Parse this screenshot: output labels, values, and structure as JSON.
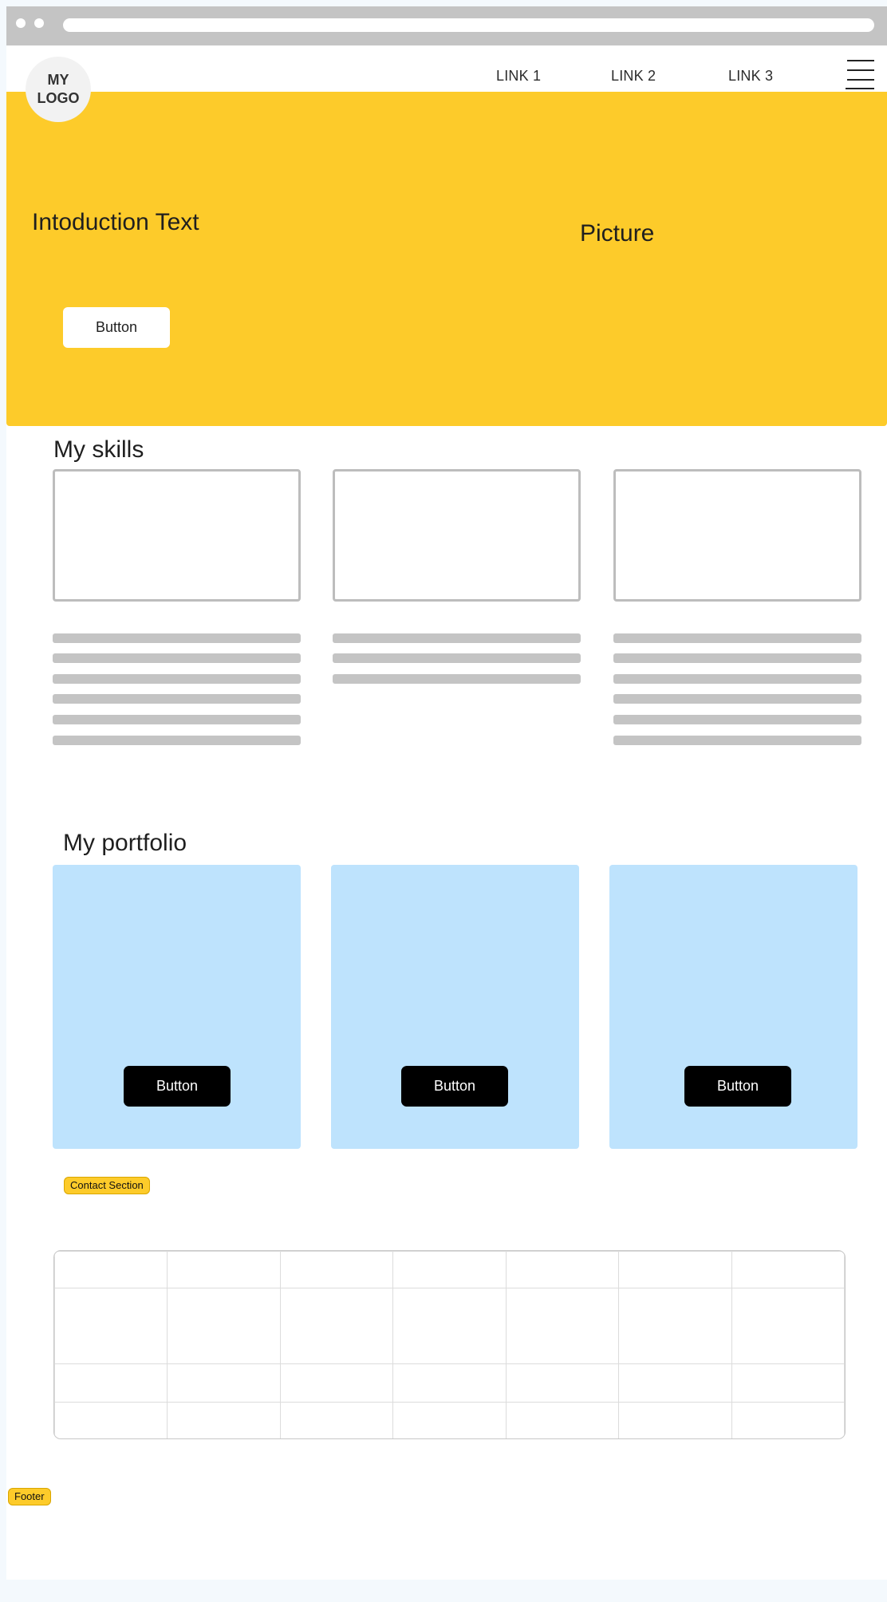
{
  "header": {
    "logo_text": "MY LOGO",
    "links": [
      "LINK 1",
      "LINK 2",
      "LINK 3"
    ]
  },
  "hero": {
    "intro_text": "Intoduction Text",
    "picture_label": "Picture",
    "button_label": "Button"
  },
  "skills": {
    "title": "My skills",
    "cards": [
      {
        "text_lines": 6
      },
      {
        "text_lines": 3
      },
      {
        "text_lines": 6
      }
    ]
  },
  "portfolio": {
    "title": "My portfolio",
    "items": [
      {
        "button_label": "Button"
      },
      {
        "button_label": "Button"
      },
      {
        "button_label": "Button"
      }
    ]
  },
  "contact": {
    "label": "Contact Section"
  },
  "footer": {
    "label": "Footer"
  },
  "colors": {
    "hero_bg": "#fdcb2a",
    "portfolio_card_bg": "#bee3fd",
    "placeholder_gray": "#c4c4c4",
    "accent_button": "#000000"
  },
  "icons": [
    "hamburger-menu-icon"
  ]
}
